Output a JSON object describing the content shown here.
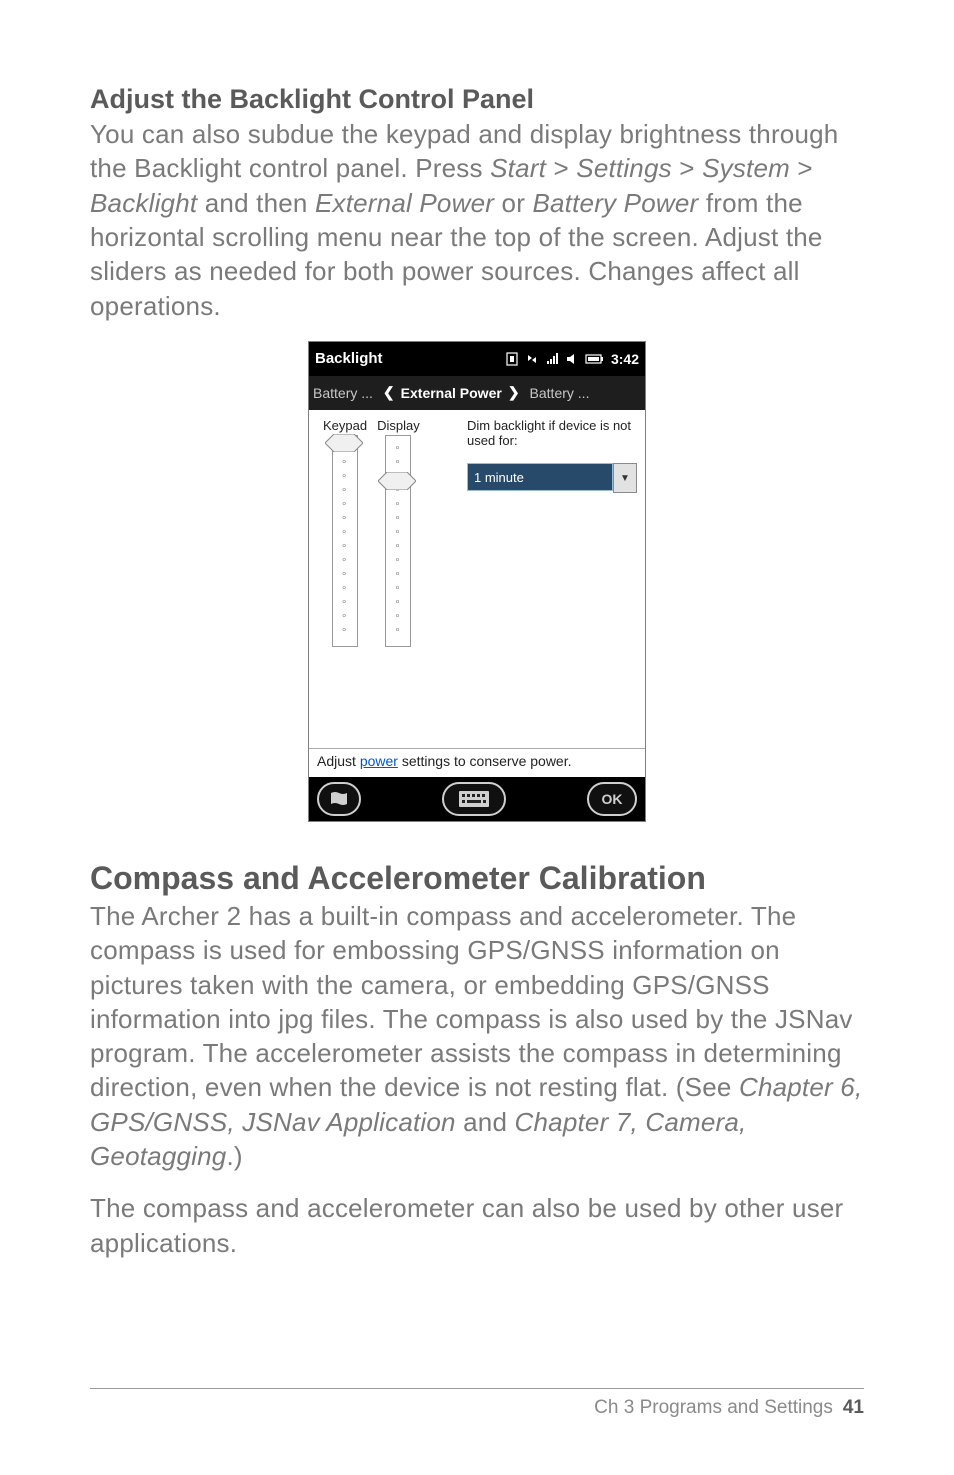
{
  "section1": {
    "heading": "Adjust the Backlight Control Panel",
    "p_a": "You can also subdue the keypad and display brightness through the Backlight control panel. Press ",
    "start": "Start",
    "gt1": " > ",
    "settings": "Settings",
    "gt2": " > ",
    "system": "System",
    "gt3": " > ",
    "backlight": "Backlight",
    "and_then": " and then ",
    "external": "External Power",
    "or": " or ",
    "battery": "Battery Power",
    "p_b": " from the horizontal scrolling menu near the top of the screen. Adjust the sliders as needed for both power sources. Changes affect all operations."
  },
  "shot": {
    "title": "Backlight",
    "clock": "3:42",
    "tab_left": "Battery ...",
    "tab_mid": "External Power",
    "tab_right": "Battery ...",
    "keypad": "Keypad",
    "display": "Display",
    "dim_text": "Dim backlight if device is not used for:",
    "timeout": "1 minute",
    "hint_a": "Adjust",
    "hint_link": "power",
    "hint_b": "settings to conserve power.",
    "ok": "OK"
  },
  "section2": {
    "heading": "Compass and Accelerometer Calibration",
    "p1_a": "The Archer 2 has a built-in compass and accelerometer. The compass is used for embossing GPS/GNSS information on pictures taken with the camera, or embedding GPS/GNSS information into jpg files. The compass is also used by the JSNav program. The accelerometer assists the compass in determining direction, even when the device is not resting flat. (See ",
    "ref1": "Chapter 6, GPS/GNSS, JSNav Application",
    "p1_b": " and ",
    "ref2": "Chapter 7, Camera, Geotagging",
    "p1_c": ".)",
    "p2": "The compass and accelerometer can also be used by other user applications."
  },
  "footer": {
    "chapter": "Ch 3   Programs and Settings",
    "page": "41"
  }
}
